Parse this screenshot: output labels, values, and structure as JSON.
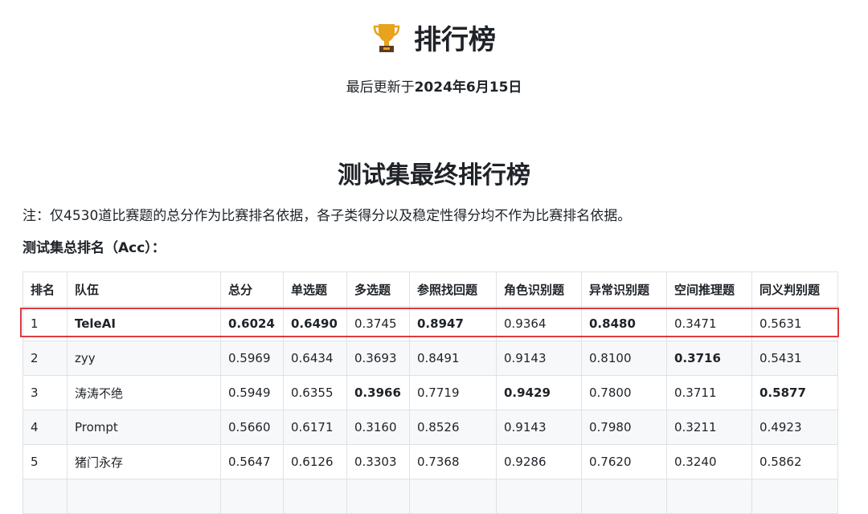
{
  "page": {
    "title": "排行榜",
    "updated_prefix": "最后更新于",
    "updated_date": "2024年6月15日",
    "section_title": "测试集最终排行榜",
    "note": "注：仅4530道比赛题的总分作为比赛排名依据，各子类得分以及稳定性得分均不作为比赛排名依据。",
    "subhead": "测试集总排名（Acc）："
  },
  "icons": {
    "title_icon": "trophy-icon"
  },
  "colors": {
    "highlight": "#e03a3e",
    "trophy_gold": "#e8a21b",
    "trophy_base": "#5b3a1e"
  },
  "table": {
    "headers": [
      "排名",
      "队伍",
      "总分",
      "单选题",
      "多选题",
      "参照找回题",
      "角色识别题",
      "异常识别题",
      "空间推理题",
      "同义判别题"
    ],
    "rows": [
      [
        "1",
        "TeleAI",
        "0.6024",
        "0.6490",
        "0.3745",
        "0.8947",
        "0.9364",
        "0.8480",
        "0.3471",
        "0.5631"
      ],
      [
        "2",
        "zyy",
        "0.5969",
        "0.6434",
        "0.3693",
        "0.8491",
        "0.9143",
        "0.8100",
        "0.3716",
        "0.5431"
      ],
      [
        "3",
        "涛涛不绝",
        "0.5949",
        "0.6355",
        "0.3966",
        "0.7719",
        "0.9429",
        "0.7800",
        "0.3711",
        "0.5877"
      ],
      [
        "4",
        "Prompt",
        "0.5660",
        "0.6171",
        "0.3160",
        "0.8526",
        "0.9143",
        "0.7980",
        "0.3211",
        "0.4923"
      ],
      [
        "5",
        "猪门永存",
        "0.5647",
        "0.6126",
        "0.3303",
        "0.7368",
        "0.9286",
        "0.7620",
        "0.3240",
        "0.5862"
      ],
      [
        "",
        "",
        "",
        "",
        "",
        "",
        "",
        "",
        "",
        ""
      ]
    ]
  }
}
